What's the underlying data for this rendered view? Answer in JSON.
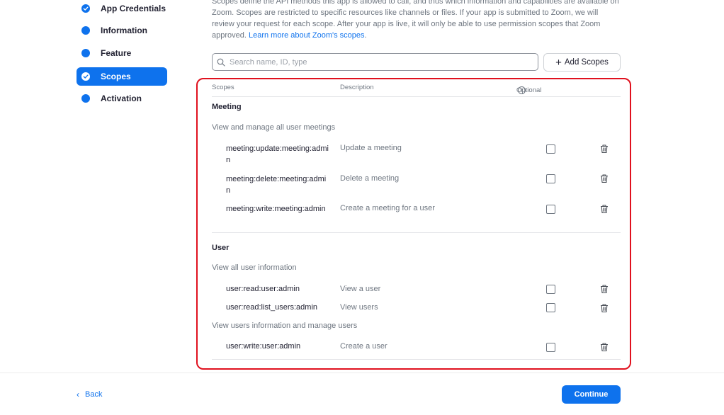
{
  "sidebar": {
    "items": [
      {
        "label": "App Credentials",
        "state": "done"
      },
      {
        "label": "Information",
        "state": "todo"
      },
      {
        "label": "Feature",
        "state": "todo"
      },
      {
        "label": "Scopes",
        "state": "active"
      },
      {
        "label": "Activation",
        "state": "todo"
      }
    ]
  },
  "intro": {
    "text": "Scopes define the API methods this app is allowed to call, and thus which information and capabilities are available on Zoom. Scopes are restricted to specific resources like channels or files. If your app is submitted to Zoom, we will review your request for each scope. After your app is live, it will only be able to use permission scopes that Zoom approved. ",
    "link": "Learn more about Zoom's scopes",
    "link_suffix": "."
  },
  "search": {
    "placeholder": "Search name, ID, type",
    "value": ""
  },
  "add_scopes_label": "Add Scopes",
  "table": {
    "headers": {
      "scopes": "Scopes",
      "description": "Description",
      "optional": "Optional",
      "optional_info": "i"
    },
    "groups": [
      {
        "title": "Meeting",
        "subgroups": [
          {
            "label": "View and manage all user meetings",
            "rows": [
              {
                "name": "meeting:update:meeting:admin",
                "description": "Update a meeting",
                "optional": false
              },
              {
                "name": "meeting:delete:meeting:admin",
                "description": "Delete a meeting",
                "optional": false
              },
              {
                "name": "meeting:write:meeting:admin",
                "description": "Create a meeting for a user",
                "optional": false
              }
            ]
          }
        ]
      },
      {
        "title": "User",
        "subgroups": [
          {
            "label": "View all user information",
            "rows": [
              {
                "name": "user:read:user:admin",
                "description": "View a user",
                "optional": false
              },
              {
                "name": "user:read:list_users:admin",
                "description": "View users",
                "optional": false
              }
            ]
          },
          {
            "label": "View users information and manage users",
            "rows": [
              {
                "name": "user:write:user:admin",
                "description": "Create a user",
                "optional": false
              }
            ]
          }
        ]
      }
    ]
  },
  "footer": {
    "back_label": "Back",
    "continue_label": "Continue"
  },
  "colors": {
    "accent": "#0e72ed",
    "highlight": "#e0111e"
  }
}
